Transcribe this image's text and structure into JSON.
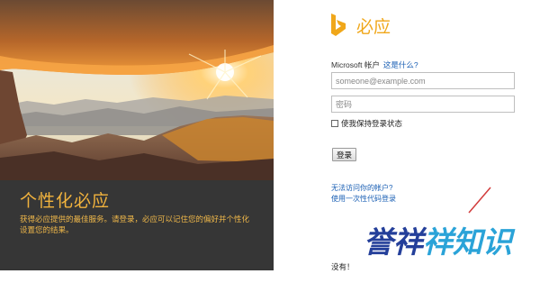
{
  "hero": {
    "title": "个性化必应",
    "description": "获得必应提供的最佳服务。请登录，必应可以记住您的偏好并个性化设置您的结果。"
  },
  "brand": {
    "name": "必应",
    "color": "#f0a71a"
  },
  "signin": {
    "account_label": "Microsoft 帐户",
    "account_help_link": "这是什么?",
    "email_placeholder": "someone@example.com",
    "password_placeholder": "密码",
    "keep_signed_in_label": "使我保持登录状态",
    "keep_signed_in_checked": false,
    "submit_label": "登录",
    "cant_access_link": "无法访问你的帐户?",
    "one_time_code_link": "使用一次性代码登录",
    "no_account_text": "没有！"
  },
  "watermark": {
    "part1": "誉祥",
    "part2": "祥知识"
  },
  "colors": {
    "hero_title": "#f2b33d",
    "link": "#1a5fb4",
    "watermark_dark": "#243f9a",
    "watermark_light": "#2aa3d8"
  }
}
